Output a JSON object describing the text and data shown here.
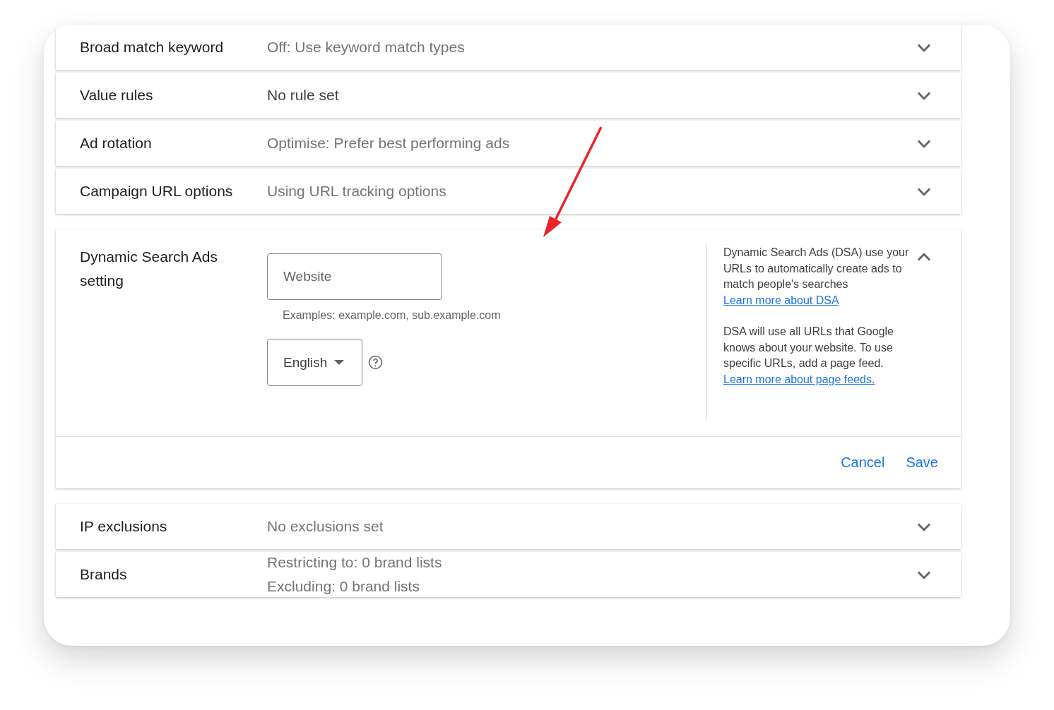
{
  "settings": [
    {
      "kind": "collapsed",
      "label": "Broad match keyword",
      "value_lines": [
        "Off: Use keyword match types"
      ],
      "dimmed": true,
      "expanded": false
    },
    {
      "kind": "collapsed",
      "label": "Value rules",
      "value_lines": [
        "No rule set"
      ],
      "dimmed": false,
      "expanded": false
    },
    {
      "kind": "collapsed",
      "label": "Ad rotation",
      "value_lines": [
        "Optimise: Prefer best performing ads"
      ],
      "dimmed": true,
      "expanded": false
    },
    {
      "kind": "collapsed",
      "label": "Campaign URL options",
      "value_lines": [
        "Using URL tracking options"
      ],
      "dimmed": true,
      "expanded": false
    },
    {
      "kind": "editor",
      "label": "Dynamic Search Ads setting",
      "expanded": true,
      "website_field": {
        "placeholder": "Website"
      },
      "hint": "Examples: example.com, sub.example.com",
      "language": "English",
      "info": [
        {
          "text": "Dynamic Search Ads (DSA) use your URLs to automatically create ads to match people's searches",
          "link": "Learn more about DSA"
        },
        {
          "text": "DSA will use all URLs that Google knows about your website. To use specific URLs, add a page feed.",
          "link": "Learn more about page feeds."
        }
      ],
      "buttons": [
        "Cancel",
        "Save"
      ]
    },
    {
      "kind": "collapsed",
      "label": "IP exclusions",
      "value_lines": [
        "No exclusions set"
      ],
      "dimmed": true,
      "expanded": false
    },
    {
      "kind": "collapsed",
      "label": "Brands",
      "value_lines": [
        "Restricting to: 0 brand lists",
        "Excluding: 0 brand lists"
      ],
      "dimmed": true,
      "expanded": false
    }
  ]
}
